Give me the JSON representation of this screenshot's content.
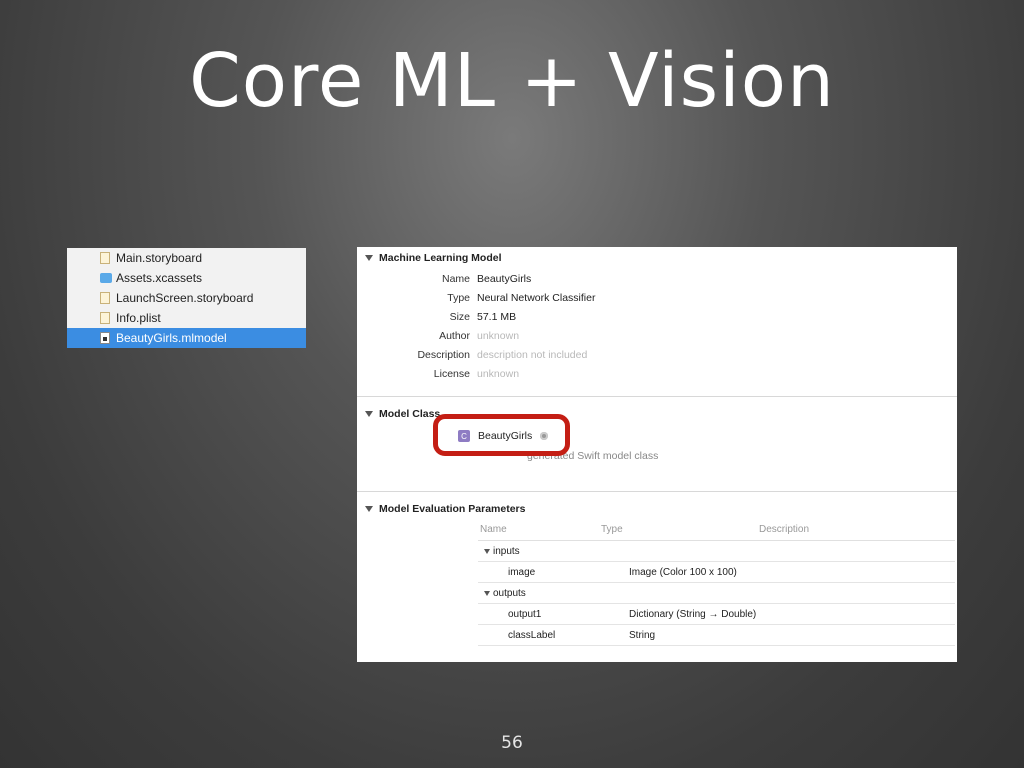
{
  "slide": {
    "title": "Core ML + Vision",
    "page_number": "56"
  },
  "navigator": {
    "files": [
      {
        "name": "Main.storyboard",
        "icon": "storyboard-file-icon",
        "selected": false
      },
      {
        "name": "Assets.xcassets",
        "icon": "asset-catalog-icon",
        "selected": false
      },
      {
        "name": "LaunchScreen.storyboard",
        "icon": "storyboard-file-icon",
        "selected": false
      },
      {
        "name": "Info.plist",
        "icon": "plist-file-icon",
        "selected": false
      },
      {
        "name": "BeautyGirls.mlmodel",
        "icon": "mlmodel-file-icon",
        "selected": true
      }
    ],
    "selection_color": "#3b8de2"
  },
  "inspector": {
    "ml_section": {
      "title": "Machine Learning Model",
      "rows": [
        {
          "key": "Name",
          "value": "BeautyGirls",
          "muted": false
        },
        {
          "key": "Type",
          "value": "Neural Network Classifier",
          "muted": false
        },
        {
          "key": "Size",
          "value": "57.1 MB",
          "muted": false
        },
        {
          "key": "Author",
          "value": "unknown",
          "muted": true
        },
        {
          "key": "Description",
          "value": "description not included",
          "muted": true
        },
        {
          "key": "License",
          "value": "unknown",
          "muted": true
        }
      ]
    },
    "class_section": {
      "title": "Model Class",
      "class_badge": "C",
      "class_name": "BeautyGirls",
      "note": "generated Swift model class",
      "highlight_color": "#c41e14"
    },
    "params_section": {
      "title": "Model Evaluation Parameters",
      "headers": {
        "name": "Name",
        "type": "Type",
        "description": "Description"
      },
      "inputs_label": "inputs",
      "inputs": [
        {
          "name": "image",
          "type": "Image (Color 100 x 100)"
        }
      ],
      "outputs_label": "outputs",
      "outputs": [
        {
          "name": "output1",
          "type": "Dictionary (String → Double)"
        },
        {
          "name": "classLabel",
          "type": "String"
        }
      ]
    }
  }
}
